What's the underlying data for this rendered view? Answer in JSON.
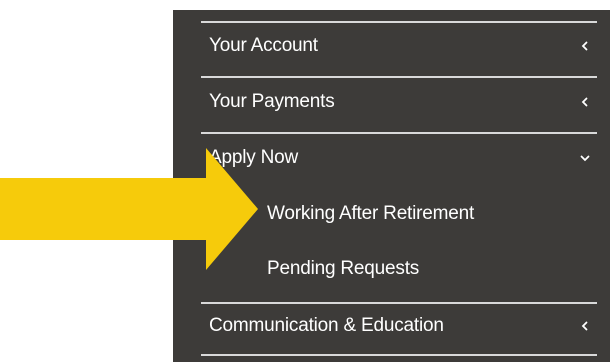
{
  "menu": {
    "items": [
      {
        "label": "Your Account",
        "icon": "chevron-left-icon"
      },
      {
        "label": "Your Payments",
        "icon": "chevron-left-icon"
      },
      {
        "label": "Apply Now",
        "icon": "chevron-down-icon"
      },
      {
        "label": "Communication & Education",
        "icon": "chevron-left-icon"
      }
    ],
    "submenu": [
      {
        "label": "Working After Retirement"
      },
      {
        "label": "Pending Requests"
      }
    ]
  },
  "colors": {
    "panel_bg": "#3d3b39",
    "divider": "#d9d9d9",
    "text": "#ffffff",
    "arrow": "#f6cb0b"
  }
}
